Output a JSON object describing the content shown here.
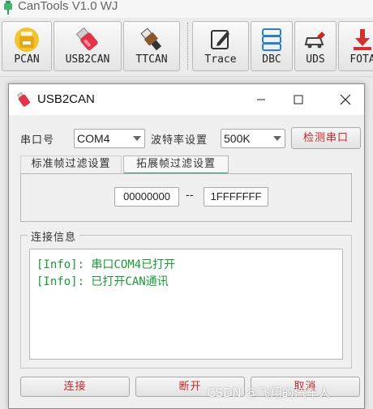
{
  "app": {
    "title": "CanTools V1.0 WJ"
  },
  "toolbar": {
    "buttons": [
      {
        "label": "PCAN",
        "icon": "pcan-icon"
      },
      {
        "label": "USB2CAN",
        "icon": "usb-drive-icon"
      },
      {
        "label": "TTCAN",
        "icon": "usb-plug-icon"
      },
      {
        "label": "Trace",
        "icon": "edit-icon"
      },
      {
        "label": "DBC",
        "icon": "database-icon"
      },
      {
        "label": "UDS",
        "icon": "car-settings-icon"
      },
      {
        "label": "FOTA",
        "icon": "download-icon"
      }
    ]
  },
  "dialog": {
    "title": "USB2CAN",
    "serial_label": "串口号",
    "serial_value": "COM4",
    "baud_label": "波特率设置",
    "baud_value": "500K",
    "detect_button": "检测串口",
    "tabs": [
      "标准帧过滤设置",
      "拓展帧过滤设置"
    ],
    "active_tab": 1,
    "filter_start": "00000000",
    "filter_sep": "--",
    "filter_end": "1FFFFFFF",
    "conn_group_label": "连接信息",
    "log": [
      "[Info]: 串口COM4已打开",
      "[Info]: 已打开CAN通讯"
    ],
    "connect_button": "连接",
    "disconnect_button": "断开",
    "cancel_button": "取消"
  },
  "watermark": "CSDN @飞翔的汽车人",
  "colors": {
    "accent_red": "#c62828",
    "log_green": "#1a9a36",
    "tab_underline": "#2fa084"
  }
}
